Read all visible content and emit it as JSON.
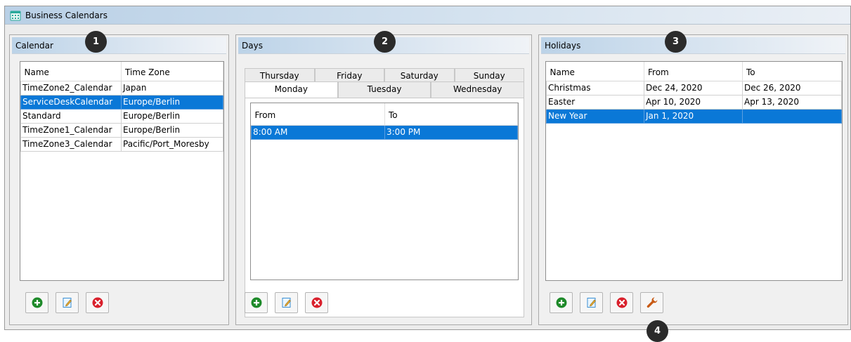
{
  "window": {
    "title": "Business Calendars"
  },
  "calendar": {
    "header": "Calendar",
    "columns": [
      "Name",
      "Time Zone"
    ],
    "rows": [
      {
        "name": "TimeZone2_Calendar",
        "tz": "Japan"
      },
      {
        "name": "ServiceDeskCalendar",
        "tz": "Europe/Berlin"
      },
      {
        "name": "Standard",
        "tz": "Europe/Berlin"
      },
      {
        "name": "TimeZone1_Calendar",
        "tz": "Europe/Berlin"
      },
      {
        "name": "TimeZone3_Calendar",
        "tz": "Pacific/Port_Moresby"
      }
    ]
  },
  "days": {
    "header": "Days",
    "tabs_row1": [
      "Thursday",
      "Friday",
      "Saturday",
      "Sunday"
    ],
    "tabs_row2": [
      "Monday",
      "Tuesday",
      "Wednesday"
    ],
    "columns": [
      "From",
      "To"
    ],
    "rows": [
      {
        "from": "8:00 AM",
        "to": "3:00 PM"
      }
    ]
  },
  "holidays": {
    "header": "Holidays",
    "columns": [
      "Name",
      "From",
      "To"
    ],
    "rows": [
      {
        "name": "Christmas",
        "from": "Dec 24, 2020",
        "to": "Dec 26, 2020"
      },
      {
        "name": "Easter",
        "from": "Apr 10, 2020",
        "to": "Apr 13, 2020"
      },
      {
        "name": "New Year",
        "from": "Jan 1, 2020",
        "to": ""
      }
    ]
  },
  "badges": [
    "1",
    "2",
    "3",
    "4"
  ],
  "icons": {
    "add": "plus-circle-icon",
    "edit": "edit-document-icon",
    "delete": "delete-x-icon",
    "configure": "wrench-icon"
  },
  "colors": {
    "selection": "#0a78d7",
    "add_green": "#1e8a2a",
    "delete_red": "#d9202c",
    "wrench_orange": "#c85a14",
    "badge": "#2b2b2b"
  }
}
